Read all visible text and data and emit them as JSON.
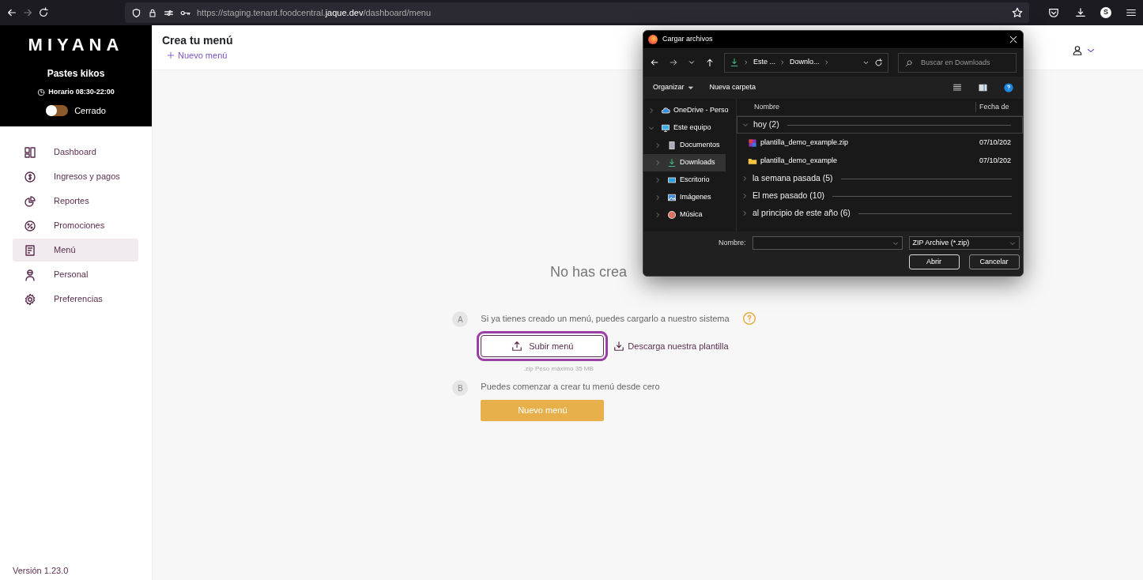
{
  "browser": {
    "url": {
      "prefix": "https://staging.tenant.foodcentral.",
      "host": "jaque.dev",
      "path": "/dashboard/menu"
    },
    "profile_initial": "S"
  },
  "sidebar": {
    "logo": "MIYANA",
    "store": "Pastes kikos",
    "hours": "Horario 08:30-22:00",
    "status": {
      "label": "Cerrado",
      "open": false
    },
    "items": [
      {
        "label": "Dashboard",
        "selected": false
      },
      {
        "label": "Ingresos y pagos",
        "selected": false
      },
      {
        "label": "Reportes",
        "selected": false
      },
      {
        "label": "Promociones",
        "selected": false
      },
      {
        "label": "Menú",
        "selected": true
      },
      {
        "label": "Personal",
        "selected": false
      },
      {
        "label": "Preferencias",
        "selected": false
      }
    ],
    "version": "Versión 1.23.0"
  },
  "header": {
    "title": "Crea tu menú",
    "new_link": "Nuevo menú"
  },
  "empty_state": {
    "heading": "No has crea",
    "steps": [
      {
        "letter": "A",
        "text": "Si ya tienes creado un menú, puedes cargarlo a nuestro sistema",
        "kind": "upload",
        "upload_button": "Subir menú",
        "download_link": "Descarga nuestra plantilla",
        "hint": ".zip Peso máximo 35 MB"
      },
      {
        "letter": "B",
        "text": "Puedes comenzar a crear tu menú desde cero",
        "kind": "create",
        "create_button": "Nuevo menú"
      }
    ]
  },
  "dialog": {
    "title": "Cargar archivos",
    "breadcrumb": [
      "Este ...",
      "Downlo..."
    ],
    "search": {
      "placeholder": "Buscar en Downloads"
    },
    "toolbar": {
      "organize": "Organizar",
      "new_folder": "Nueva carpeta"
    },
    "nav": [
      {
        "label": "OneDrive - Perso",
        "expanded": false,
        "selected": false
      },
      {
        "label": "Este equipo",
        "expanded": true,
        "selected": false,
        "children": [
          {
            "label": "Documentos",
            "expanded": false,
            "selected": false
          },
          {
            "label": "Downloads",
            "expanded": false,
            "selected": true
          },
          {
            "label": "Escritorio",
            "expanded": false,
            "selected": false
          },
          {
            "label": "Imágenes",
            "expanded": false,
            "selected": false
          },
          {
            "label": "Música",
            "expanded": false,
            "selected": false
          }
        ]
      }
    ],
    "columns": [
      "Nombre",
      "Fecha de"
    ],
    "groups": [
      {
        "label": "hoy (2)",
        "expanded": true,
        "files": [
          {
            "name": "plantilla_demo_example.zip",
            "kind": "zip",
            "date": "07/10/202"
          },
          {
            "name": "plantilla_demo_example",
            "kind": "folder",
            "date": "07/10/202"
          }
        ]
      },
      {
        "label": "la semana pasada (5)",
        "expanded": false
      },
      {
        "label": "El mes pasado (10)",
        "expanded": false
      },
      {
        "label": "al principio de este año (6)",
        "expanded": false
      }
    ],
    "filename_label": "Nombre:",
    "filter": "ZIP Archive (*.zip)",
    "open_button": "Abrir",
    "cancel_button": "Cancelar"
  }
}
